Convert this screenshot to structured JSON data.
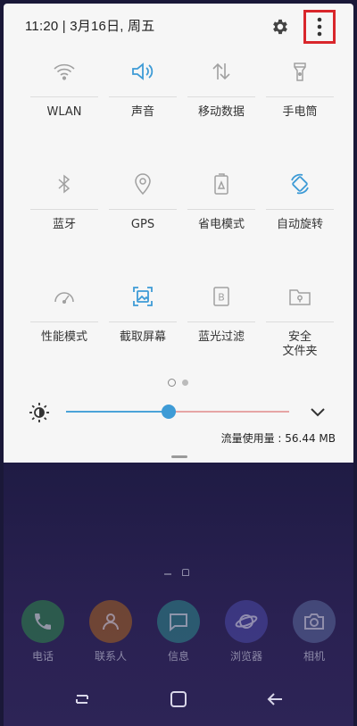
{
  "status_bar": {
    "time_date": "11:20 | 3月16日, 周五"
  },
  "quick_settings": [
    {
      "label": "WLAN",
      "icon": "wifi-icon",
      "active": false
    },
    {
      "label": "声音",
      "icon": "sound-icon",
      "active": true
    },
    {
      "label": "移动数据",
      "icon": "mobile-data-icon",
      "active": false
    },
    {
      "label": "手电筒",
      "icon": "flashlight-icon",
      "active": false
    },
    {
      "label": "蓝牙",
      "icon": "bluetooth-icon",
      "active": false
    },
    {
      "label": "GPS",
      "icon": "location-icon",
      "active": false
    },
    {
      "label": "省电模式",
      "icon": "battery-saver-icon",
      "active": false
    },
    {
      "label": "自动旋转",
      "icon": "auto-rotate-icon",
      "active": true
    },
    {
      "label": "性能模式",
      "icon": "performance-icon",
      "active": false
    },
    {
      "label": "截取屏幕",
      "icon": "screenshot-icon",
      "active": true
    },
    {
      "label": "蓝光过滤",
      "icon": "blue-light-filter-icon",
      "active": false
    },
    {
      "label": "安全\n文件夹",
      "label_lines": [
        "安全",
        "文件夹"
      ],
      "icon": "secure-folder-icon",
      "active": false
    }
  ],
  "brightness": {
    "level": 0.46
  },
  "data_usage": "流量使用量 : 56.44 MB",
  "dock": [
    {
      "label": "电话",
      "icon": "phone-icon",
      "color": "#2f8a4a"
    },
    {
      "label": "联系人",
      "icon": "contacts-icon",
      "color": "#a8641f"
    },
    {
      "label": "信息",
      "icon": "messages-icon",
      "color": "#2d8a8a"
    },
    {
      "label": "浏览器",
      "icon": "browser-icon",
      "color": "#4b4aa8"
    },
    {
      "label": "相机",
      "icon": "camera-icon",
      "color": "#5a6a9a"
    }
  ],
  "colors": {
    "accent": "#3e9bd6",
    "highlight_box": "#d9262b",
    "inactive_icon": "#9a9a9a"
  }
}
